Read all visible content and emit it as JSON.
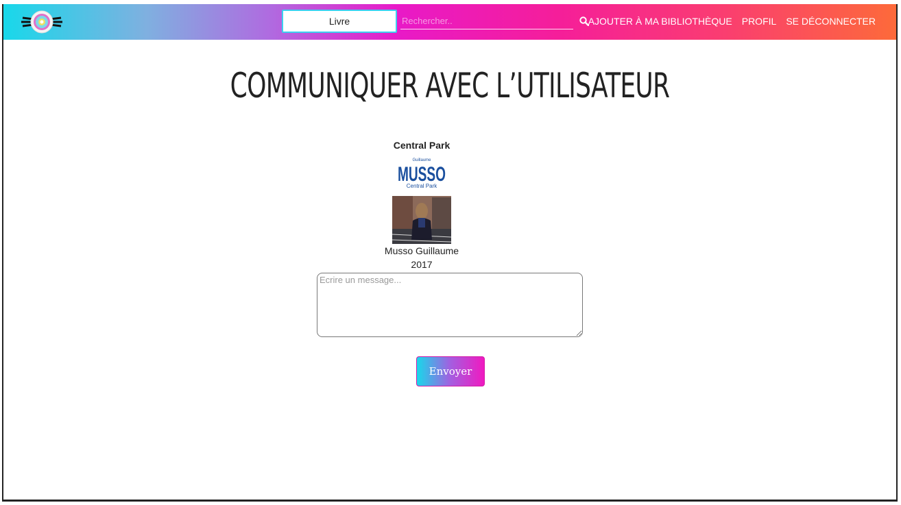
{
  "navbar": {
    "category_select": "Livre",
    "search_placeholder": "Rechercher..",
    "links": [
      "AJOUTER À MA BIBLIOTHÈQUE",
      "PROFIL",
      "SE DÉCONNECTER"
    ]
  },
  "page": {
    "title": "COMMUNIQUER AVEC L’UTILISATEUR"
  },
  "book": {
    "title": "Central Park",
    "cover_author_first": "Guillaume",
    "cover_author_last": "MUSSO",
    "cover_title": "Central Park",
    "author": "Musso Guillaume",
    "year": "2017"
  },
  "form": {
    "message_placeholder": "Ecrire un message...",
    "send_label": "Envoyer"
  },
  "colors": {
    "gradient_start": "#18d8ea",
    "gradient_mid": "#e81ac8",
    "gradient_end": "#fd6a3a",
    "cover_blue": "#1a4f9e"
  },
  "icons": [
    "logo-icon",
    "search-icon"
  ]
}
